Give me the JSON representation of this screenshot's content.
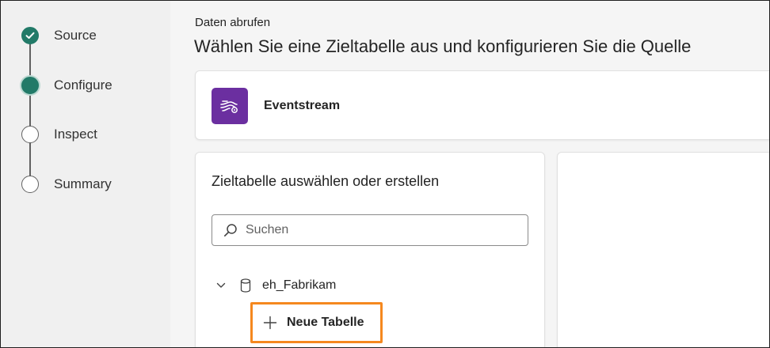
{
  "stepper": {
    "steps": [
      {
        "label": "Source",
        "state": "done"
      },
      {
        "label": "Configure",
        "state": "current"
      },
      {
        "label": "Inspect",
        "state": "pending"
      },
      {
        "label": "Summary",
        "state": "pending"
      }
    ]
  },
  "header": {
    "eyebrow": "Daten abrufen",
    "title": "Wählen Sie eine Zieltabelle aus und konfigurieren Sie die Quelle"
  },
  "source": {
    "name": "Eventstream",
    "icon": "eventstream-icon"
  },
  "table_panel": {
    "title": "Zieltabelle auswählen oder erstellen",
    "search_placeholder": "Suchen",
    "database": {
      "name": "eh_Fabrikam",
      "expanded": true
    },
    "new_table_label": "Neue Tabelle"
  },
  "colors": {
    "accent": "#227a68",
    "eventstream": "#6b2fa0",
    "highlight": "#f5881f"
  }
}
